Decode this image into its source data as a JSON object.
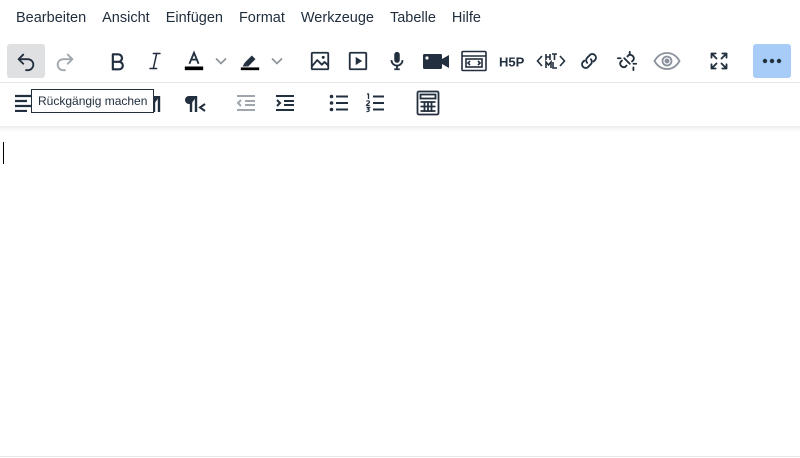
{
  "menubar": {
    "items": [
      "Bearbeiten",
      "Ansicht",
      "Einfügen",
      "Format",
      "Werkzeuge",
      "Tabelle",
      "Hilfe"
    ]
  },
  "toolbar1": {
    "buttons": [
      {
        "icon": "undo-icon",
        "state": "active"
      },
      {
        "icon": "redo-icon",
        "state": "disabled"
      },
      {
        "icon": "bold-icon"
      },
      {
        "icon": "italic-icon"
      },
      {
        "icon": "text-color-icon",
        "split": true
      },
      {
        "icon": "highlight-color-icon",
        "split": true
      },
      {
        "icon": "image-icon"
      },
      {
        "icon": "media-icon"
      },
      {
        "icon": "microphone-icon"
      },
      {
        "icon": "video-camera-icon"
      },
      {
        "icon": "embed-icon"
      },
      {
        "icon": "h5p-icon",
        "text": "H5P"
      },
      {
        "icon": "html-icon"
      },
      {
        "icon": "link-icon"
      },
      {
        "icon": "unlink-icon"
      },
      {
        "icon": "preview-icon"
      },
      {
        "icon": "fullscreen-icon"
      },
      {
        "icon": "more-icon",
        "state": "toggled"
      }
    ]
  },
  "toolbar2": {
    "buttons": [
      {
        "icon": "align-icon"
      },
      {
        "icon": "ltr-icon"
      },
      {
        "icon": "rtl-icon"
      },
      {
        "icon": "outdent-icon",
        "state": "disabled"
      },
      {
        "icon": "indent-icon"
      },
      {
        "icon": "bullet-list-icon"
      },
      {
        "icon": "numbered-list-icon"
      },
      {
        "icon": "calculator-icon"
      }
    ]
  },
  "tooltip": {
    "text": "Rückgängig machen"
  },
  "colors": {
    "icon": "#222f3e",
    "disabled": "#a0a6ad",
    "active_bg": "#dee0e2",
    "toggled_bg": "#a6ccf7",
    "text_color_bar": "#000000",
    "highlight_bar": "#000000"
  }
}
